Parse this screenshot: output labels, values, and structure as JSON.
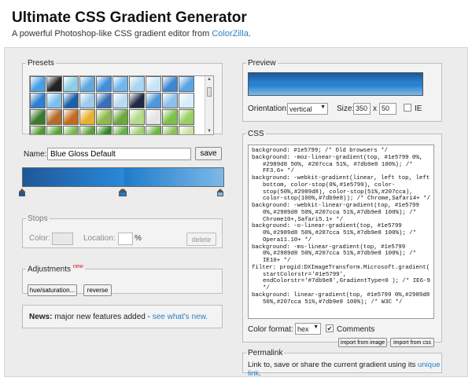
{
  "header": {
    "title": "Ultimate CSS Gradient Generator",
    "subtitle_prefix": "A powerful Photoshop-like CSS gradient editor from ",
    "subtitle_link": "ColorZilla",
    "subtitle_suffix": "."
  },
  "presets": {
    "legend": "Presets",
    "swatch_colors": [
      "#4aa0e6",
      "#222222",
      "#8ecde8",
      "#5fa8e0",
      "#3f8fdb",
      "#6fb5ee",
      "#a8d5f2",
      "#c8e5f7",
      "#3a86cf",
      "#5aa5e3",
      "#2d7fd0",
      "#7fc0ea",
      "#1a5fa8",
      "#9ccbeb",
      "#3670b8",
      "#b9dcf3",
      "#202a44",
      "#4e97d8",
      "#8cc1ea",
      "#d8ecfa",
      "#3c7a2e",
      "#b36a2a",
      "#c46a1c",
      "#e9b030",
      "#8fb94a",
      "#6da83e",
      "#b6d98a",
      "#e4e4e4",
      "#7cc14a",
      "#9ccf62",
      "#4c9a2a",
      "#5aa634",
      "#78b648",
      "#58a030",
      "#2e8a1e",
      "#64b040",
      "#a0d070",
      "#6ab63e",
      "#86c452",
      "#c8e0a0"
    ]
  },
  "name_row": {
    "label": "Name:",
    "value": "Blue Gloss Default",
    "save_label": "save"
  },
  "gradient": {
    "stops": [
      {
        "color": "#1e5799",
        "position": 0
      },
      {
        "color": "#2989d8",
        "position": 50
      },
      {
        "color": "#207cca",
        "position": 51
      },
      {
        "color": "#7db9e8",
        "position": 100
      }
    ]
  },
  "stops_panel": {
    "legend": "Stops",
    "color_label": "Color:",
    "location_label": "Location:",
    "percent": "%",
    "delete_label": "delete"
  },
  "adjustments": {
    "legend": "Adjustments",
    "new_badge": "new",
    "hue_label": "hue/saturation...",
    "reverse_label": "reverse"
  },
  "news": {
    "bold": "News:",
    "text": " major new features added - ",
    "link": "see what's new."
  },
  "preview": {
    "legend": "Preview",
    "orientation_label": "Orientation:",
    "orientation_value": "vertical",
    "size_label": "Size:",
    "width": "350",
    "x": "x",
    "height": "50",
    "ie_label": "IE"
  },
  "css_panel": {
    "legend": "CSS",
    "lines": [
      "background: #1e5799; /* Old browsers */",
      "background: -moz-linear-gradient(top, #1e5799 0%, #2989d8 50%, #207cca 51%, #7db9e8 100%); /* FF3.6+ */",
      "background: -webkit-gradient(linear, left top, left bottom, color-stop(0%,#1e5799), color-stop(50%,#2989d8), color-stop(51%,#207cca), color-stop(100%,#7db9e8)); /* Chrome,Safari4+ */",
      "background: -webkit-linear-gradient(top, #1e5799 0%,#2989d8 50%,#207cca 51%,#7db9e8 100%); /* Chrome10+,Safari5.1+ */",
      "background: -o-linear-gradient(top, #1e5799 0%,#2989d8 50%,#207cca 51%,#7db9e8 100%); /* Opera11.10+ */",
      "background: -ms-linear-gradient(top, #1e5799 0%,#2989d8 50%,#207cca 51%,#7db9e8 100%); /* IE10+ */",
      "filter: progid:DXImageTransform.Microsoft.gradient( startColorstr='#1e5799', endColorstr='#7db9e8',GradientType=0 ); /* IE6-9 */",
      "background: linear-gradient(top, #1e5799 0%,#2989d8 50%,#207cca 51%,#7db9e8 100%); /* W3C */"
    ],
    "format_label": "Color format:",
    "format_value": "hex",
    "comments_label": "Comments",
    "import_image_label": "import from image",
    "import_css_label": "import from css"
  },
  "permalink": {
    "legend": "Permalink",
    "text": "Link to, save or share the current gradient using its ",
    "link": "unique link",
    "suffix": "."
  }
}
